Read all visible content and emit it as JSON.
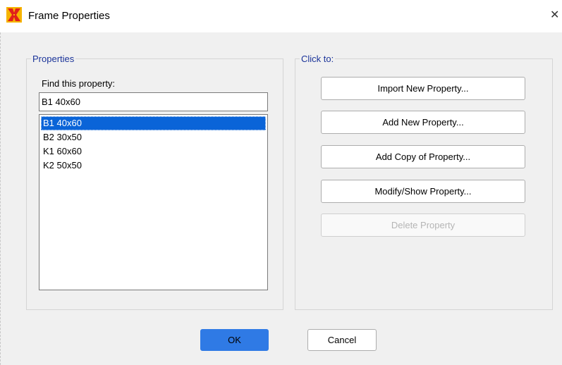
{
  "window": {
    "title": "Frame Properties",
    "close_glyph": "✕",
    "icon": "sap-x-icon"
  },
  "properties_panel": {
    "legend": "Properties",
    "find_label": "Find this property:",
    "find_value": "B1 40x60",
    "items": [
      {
        "label": "B1 40x60",
        "selected": true
      },
      {
        "label": "B2 30x50",
        "selected": false
      },
      {
        "label": "K1 60x60",
        "selected": false
      },
      {
        "label": "K2 50x50",
        "selected": false
      }
    ]
  },
  "actions_panel": {
    "legend": "Click to:",
    "buttons": [
      {
        "label": "Import New Property...",
        "enabled": true
      },
      {
        "label": "Add New Property...",
        "enabled": true
      },
      {
        "label": "Add Copy of Property...",
        "enabled": true
      },
      {
        "label": "Modify/Show Property...",
        "enabled": true
      },
      {
        "label": "Delete Property",
        "enabled": false
      }
    ]
  },
  "footer": {
    "ok_label": "OK",
    "cancel_label": "Cancel"
  },
  "colors": {
    "selection": "#0a64d8",
    "legend_text": "#1a3399",
    "ok_button": "#2f7ae5"
  }
}
